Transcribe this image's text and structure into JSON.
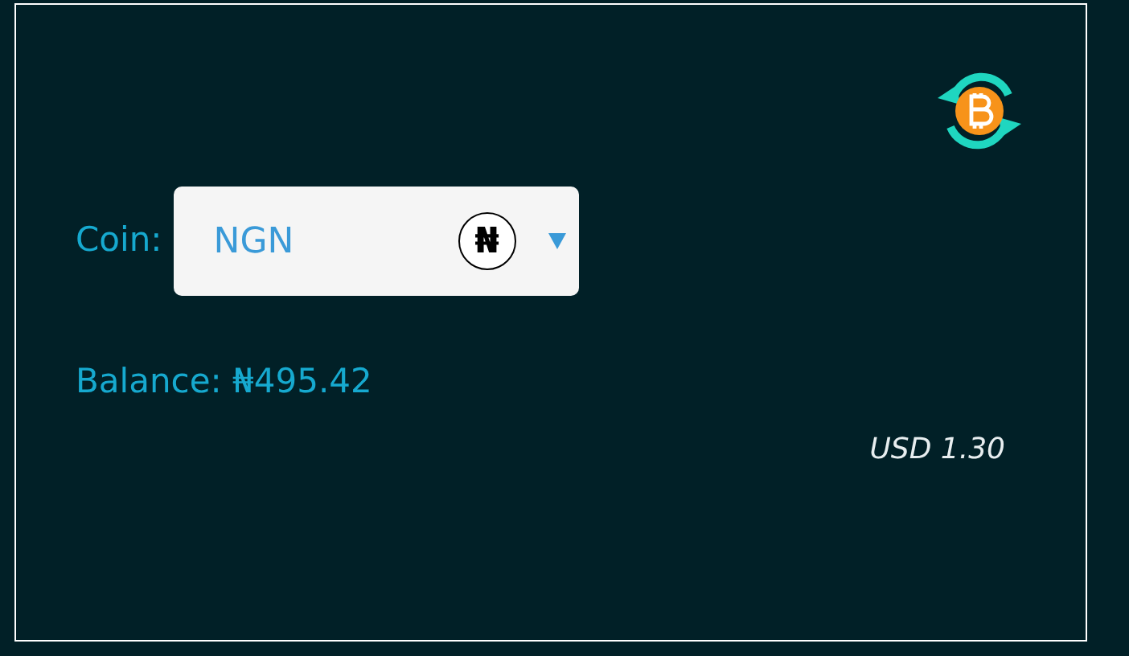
{
  "coin_label": "Coin:",
  "select": {
    "value": "NGN",
    "symbol": "₦"
  },
  "balance": "Balance: ₦495.42",
  "usd": "USD 1.30"
}
